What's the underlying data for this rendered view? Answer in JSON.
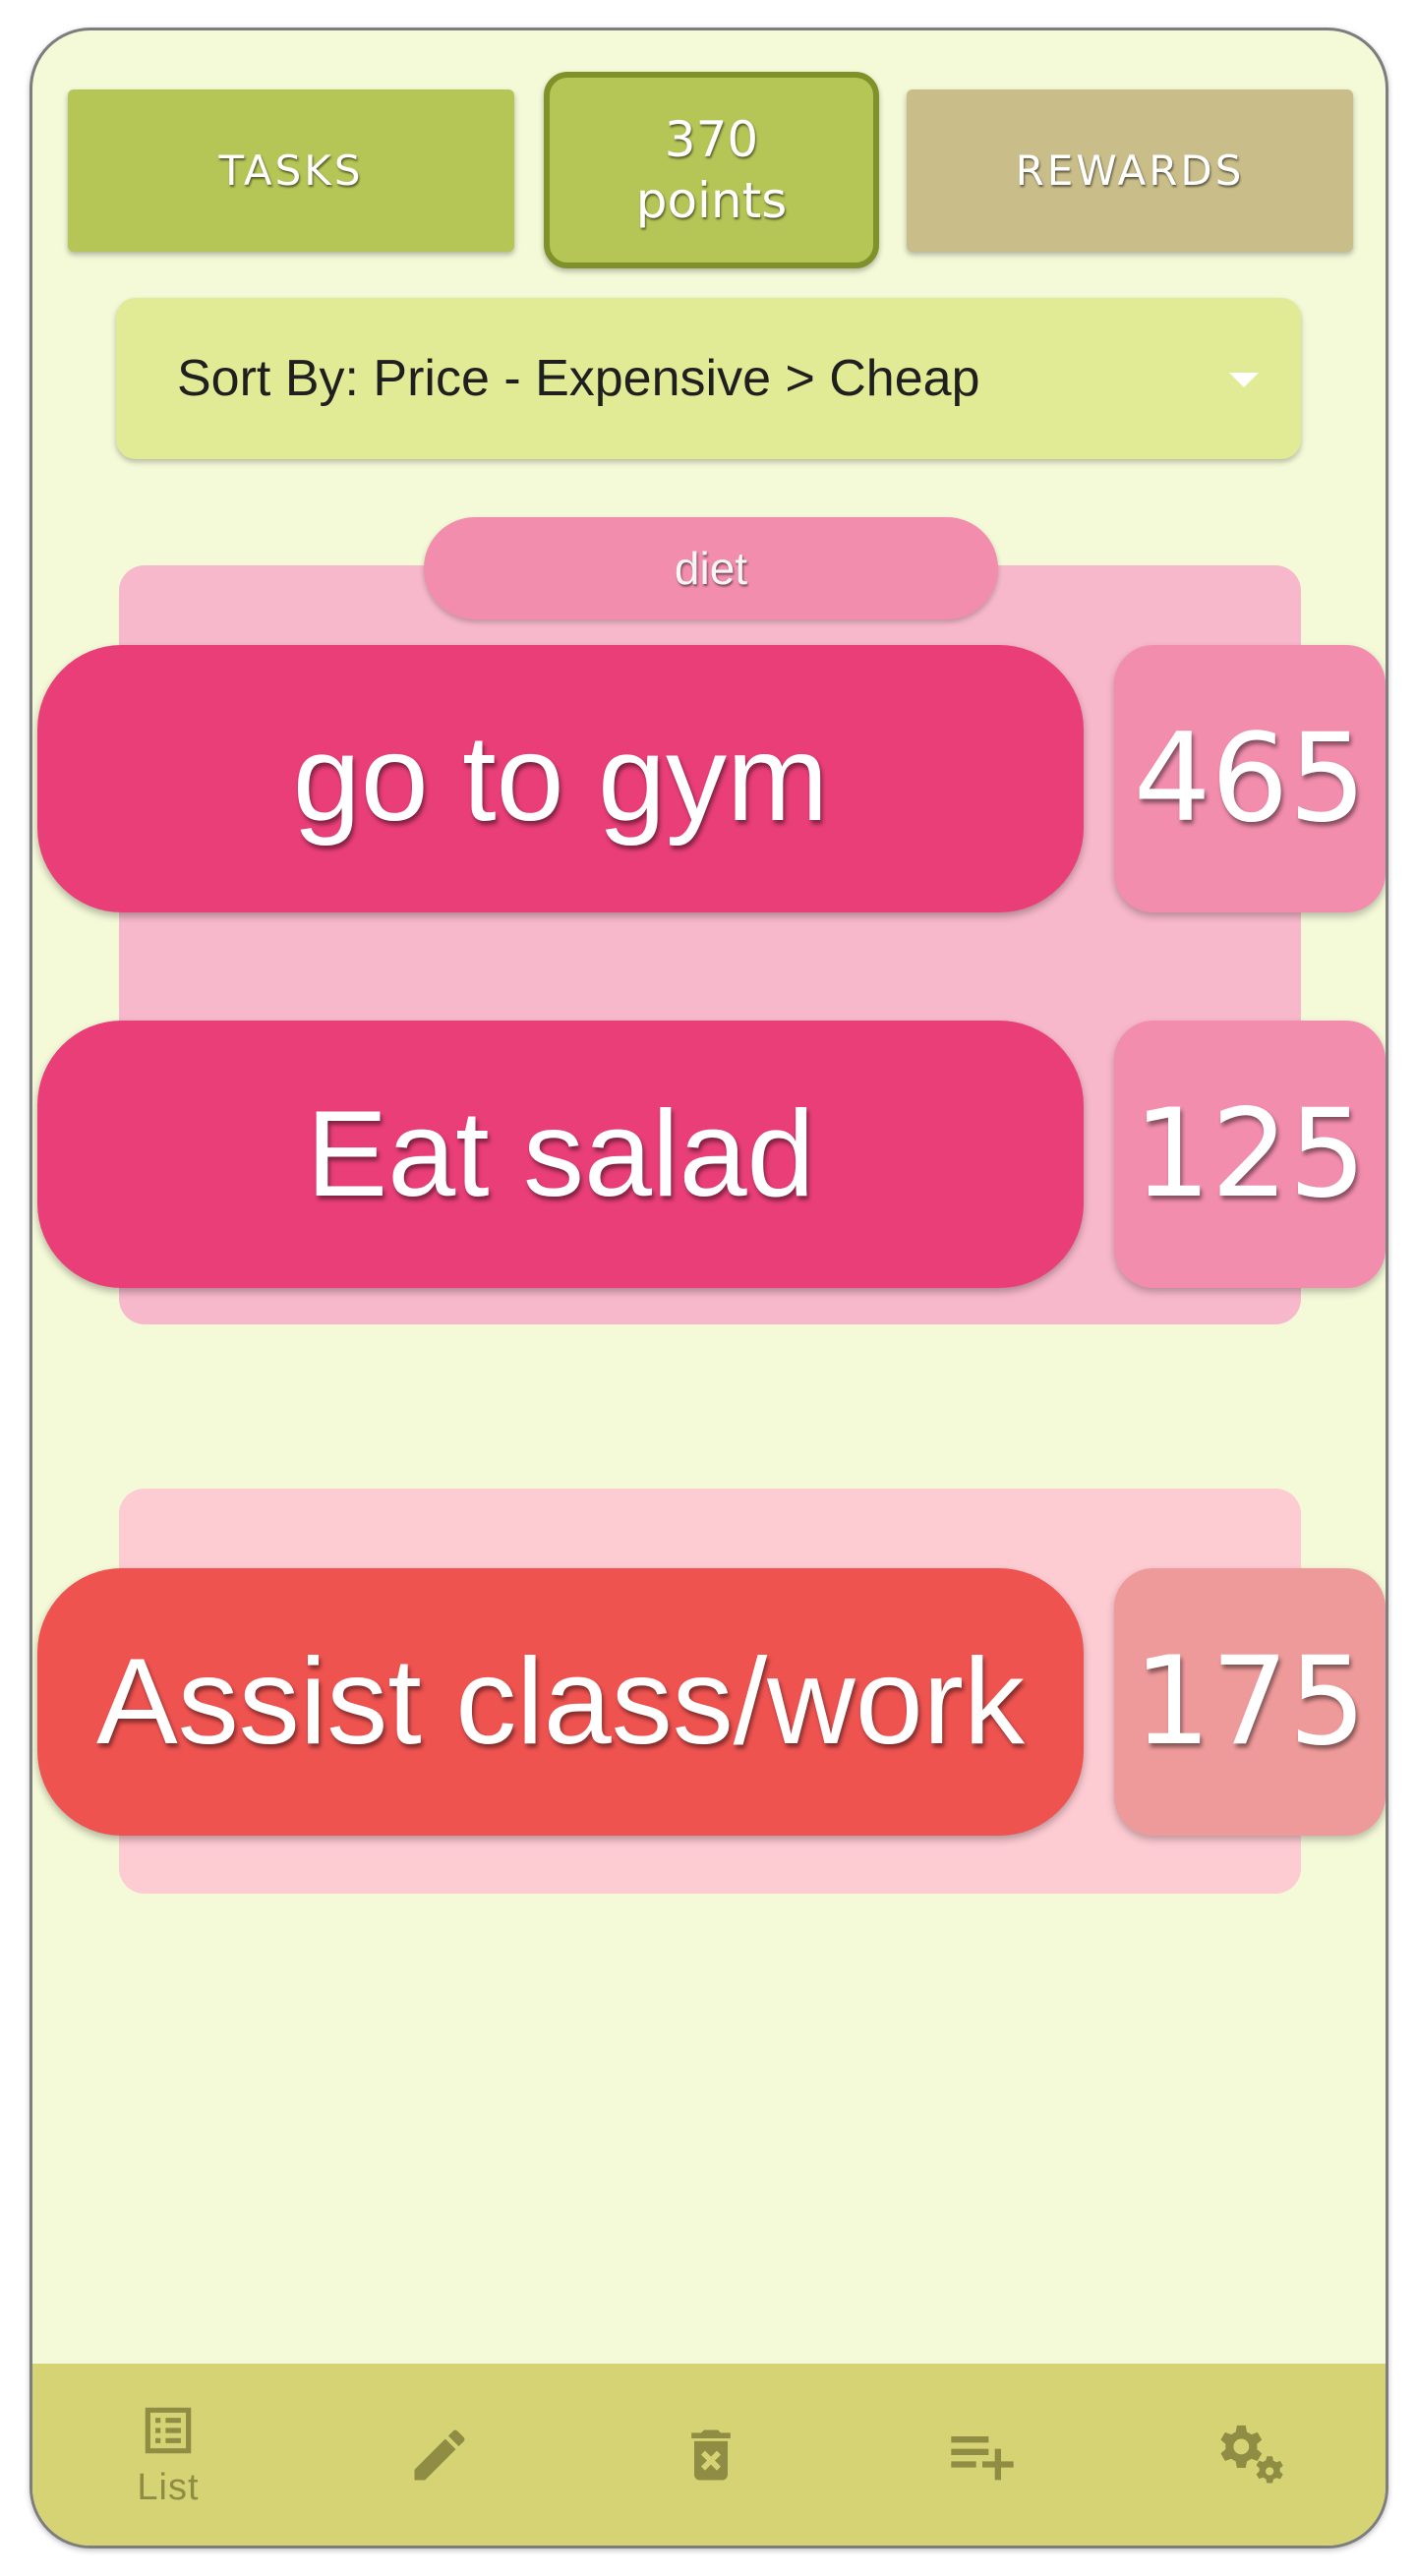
{
  "header": {
    "tasks_label": "TASKS",
    "points_value": "370",
    "points_unit": "points",
    "rewards_label": "REWARDS"
  },
  "sort": {
    "selected": "Sort By: Price - Expensive > Cheap"
  },
  "groups": [
    {
      "label": "diet",
      "items": [
        {
          "name": "go to gym",
          "price": "465"
        },
        {
          "name": "Eat salad",
          "price": "125"
        }
      ]
    },
    {
      "label": "",
      "items": [
        {
          "name": "Assist class/work",
          "price": "175"
        }
      ]
    }
  ],
  "bottom_nav": {
    "list_label": "List",
    "icons": [
      "list-icon",
      "edit-icon",
      "delete-icon",
      "playlist-add-icon",
      "settings-icon"
    ]
  },
  "colors": {
    "background": "#f4f9d8",
    "accent_green": "#b5c556",
    "rewards_tan": "#c9bd89",
    "diet_pink": "#e93e78",
    "diet_price_pink": "#f28dae",
    "other_red": "#ef5350",
    "other_price_red": "#ef9a9a",
    "nav_bar": "#d5d374"
  }
}
